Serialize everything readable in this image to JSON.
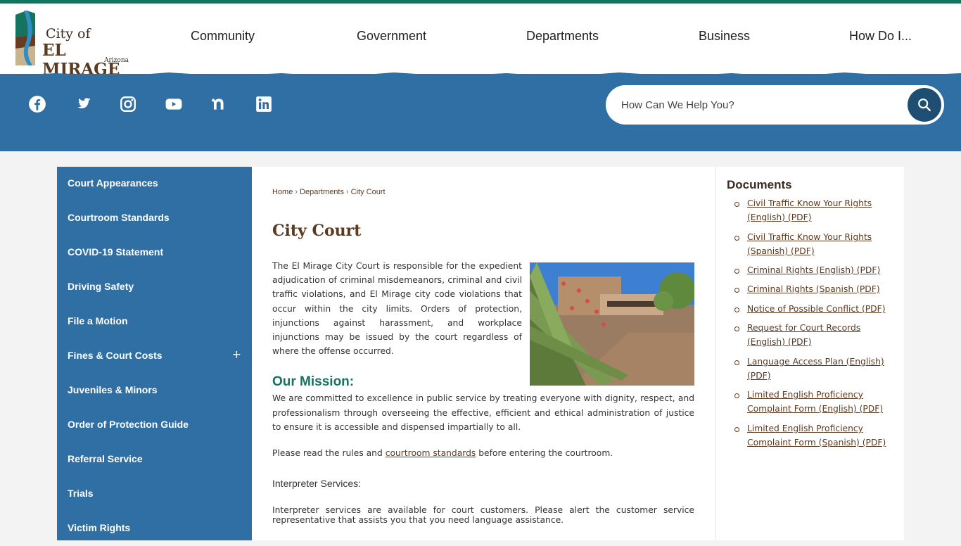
{
  "brand": {
    "logo_line1": "City of",
    "logo_line2": "EL MIRAGE",
    "logo_line3": "Arizona",
    "colors": {
      "topbar": "#16735f",
      "banner": "#2f6fa3",
      "accent_green": "#16735f",
      "brown": "#5a3a20"
    }
  },
  "nav": {
    "items": [
      "Community",
      "Government",
      "Departments",
      "Business",
      "How Do I..."
    ]
  },
  "social": {
    "icons": [
      "facebook-icon",
      "twitter-icon",
      "instagram-icon",
      "youtube-icon",
      "nextdoor-icon",
      "linkedin-icon"
    ]
  },
  "search": {
    "placeholder": "How Can We Help You?",
    "button_icon": "search-icon"
  },
  "sidebar": {
    "items": [
      {
        "label": "Court Appearances"
      },
      {
        "label": "Courtroom Standards"
      },
      {
        "label": "COVID-19 Statement"
      },
      {
        "label": "Driving Safety"
      },
      {
        "label": "File a Motion"
      },
      {
        "label": "Fines & Court Costs",
        "expand": "+"
      },
      {
        "label": "Juveniles & Minors"
      },
      {
        "label": "Order of Protection Guide"
      },
      {
        "label": "Referral Service"
      },
      {
        "label": "Trials"
      },
      {
        "label": "Victim Rights"
      }
    ]
  },
  "breadcrumb": {
    "items": [
      "Home",
      "Departments",
      "City Court"
    ],
    "separator": "›"
  },
  "main": {
    "title": "City Court",
    "intro": "The El Mirage City Court is responsible for the expedient adjudication of criminal misdemeanors, criminal and civil traffic violations, and El Mirage city code violations that occur within the city limits. Orders of protection, injunctions against harassment, and workplace injunctions may be issued by the court regardless of where the offense occurred.",
    "mission_heading": "Our Mission:",
    "mission": "We are committed to excellence in public service by treating everyone with dignity, respect, and professionalism through overseeing the effective, efficient and ethical administration of justice to ensure it is accessible and dispensed impartially to all.",
    "rules_before": "Please read the rules and ",
    "rules_link": "courtroom standards",
    "rules_after": " before entering the courtroom.",
    "interp_heading": "Interpreter Services:",
    "interp": "Interpreter services are available for court customers. Please alert the customer service representative that assists you that you need language assistance."
  },
  "documents": {
    "heading": "Documents",
    "items": [
      "Civil Traffic Know Your Rights (English) (PDF)",
      "Civil Traffic Know Your Rights (Spanish) (PDF)",
      "Criminal Rights (English) (PDF)",
      "Criminal Rights (Spanish (PDF)",
      "Notice of Possible Conflict (PDF)",
      "Request for Court Records (English) (PDF)",
      "Language Access Plan (English) (PDF)",
      "Limited English Proficiency Complaint Form (English) (PDF)",
      "Limited English Proficiency Complaint Form (Spanish) (PDF)"
    ]
  }
}
